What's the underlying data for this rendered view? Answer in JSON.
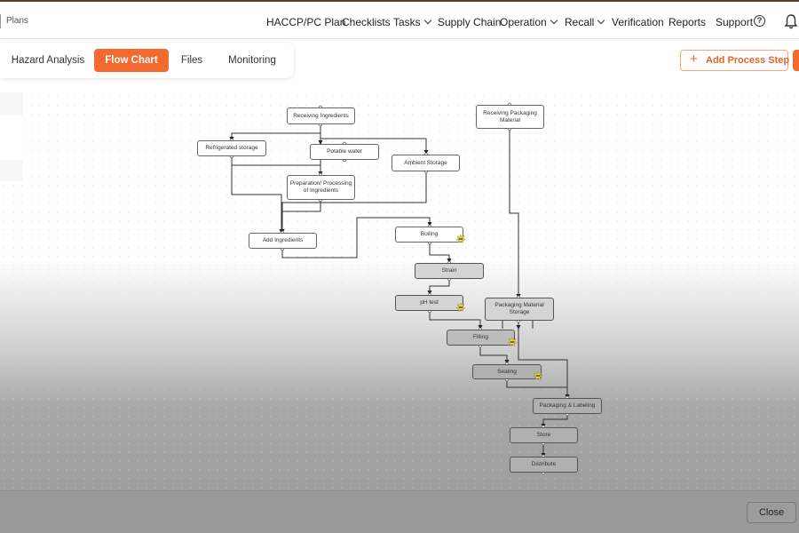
{
  "header": {
    "breadcrumb": "Plans",
    "nav": [
      {
        "label": "HACCP/PC Plan",
        "dropdown": false
      },
      {
        "label": "Checklists",
        "dropdown": false
      },
      {
        "label": "Tasks",
        "dropdown": true
      },
      {
        "label": "Supply Chain",
        "dropdown": false
      },
      {
        "label": "Operation",
        "dropdown": true
      },
      {
        "label": "Recall",
        "dropdown": true
      },
      {
        "label": "Verification",
        "dropdown": false
      },
      {
        "label": "Reports",
        "dropdown": false
      },
      {
        "label": "Support",
        "dropdown": false
      }
    ],
    "help_icon": "question-circle-icon",
    "bell_icon": "bell-icon"
  },
  "tabs": [
    {
      "label": "Hazard Analysis",
      "active": false
    },
    {
      "label": "Flow Chart",
      "active": true
    },
    {
      "label": "Files",
      "active": false
    },
    {
      "label": "Monitoring",
      "active": false
    }
  ],
  "actions": {
    "add_step_label": "Add Process Step",
    "add_icon": "plus-icon"
  },
  "flowchart": {
    "nodes": [
      {
        "id": "receiving-ingredients",
        "label": "Receiving Ingredients"
      },
      {
        "id": "receiving-packaging",
        "label": "Receiving Packaging Material"
      },
      {
        "id": "refrigerated-storage",
        "label": "Refrigerated storage"
      },
      {
        "id": "potable-water",
        "label": "Potable water"
      },
      {
        "id": "ambient-storage",
        "label": "Ambient Storage"
      },
      {
        "id": "preparation",
        "label": "Preparation/ Processing of Ingredients"
      },
      {
        "id": "add-ingredients",
        "label": "Add Ingredients"
      },
      {
        "id": "boiling",
        "label": "Boiling",
        "ccp": true
      },
      {
        "id": "strain",
        "label": "Strain"
      },
      {
        "id": "ph-test",
        "label": "pH test",
        "ccp": true
      },
      {
        "id": "packaging-material-storage",
        "label": "Packaging Material Storage"
      },
      {
        "id": "filling",
        "label": "Filling",
        "ccp": true
      },
      {
        "id": "sealing",
        "label": "Sealing",
        "ccp": true
      },
      {
        "id": "packaging-labeling",
        "label": "Packaging & Labeling"
      },
      {
        "id": "store",
        "label": "Store"
      },
      {
        "id": "distribute",
        "label": "Distribute"
      }
    ],
    "ccp_badge": "CCP",
    "ccp_icon": "ccp-star-badge-icon"
  },
  "footer": {
    "close_label": "Close"
  }
}
